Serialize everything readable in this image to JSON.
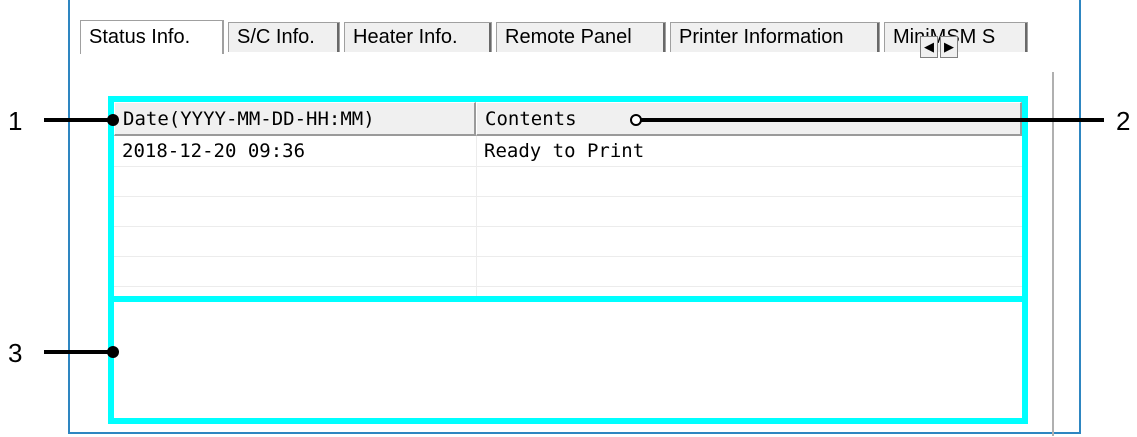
{
  "tabs": [
    {
      "label": "Status Info.",
      "active": true
    },
    {
      "label": "S/C Info.",
      "active": false
    },
    {
      "label": "Heater Info.",
      "active": false
    },
    {
      "label": "Remote Panel",
      "active": false
    },
    {
      "label": "Printer Information",
      "active": false
    },
    {
      "label": "MiniMSM S",
      "active": false
    }
  ],
  "tab_scroll": {
    "left": "◀",
    "right": "▶"
  },
  "table": {
    "headers": [
      "Date(YYYY-MM-DD-HH:MM)",
      "Contents"
    ],
    "rows": [
      [
        "2018-12-20 09:36",
        "Ready to Print"
      ],
      [
        "",
        ""
      ],
      [
        "",
        ""
      ],
      [
        "",
        ""
      ],
      [
        "",
        ""
      ]
    ]
  },
  "callouts": [
    "1",
    "2",
    "3"
  ],
  "colors": {
    "highlight": "#00ffff",
    "window_border": "#2e86c1"
  }
}
